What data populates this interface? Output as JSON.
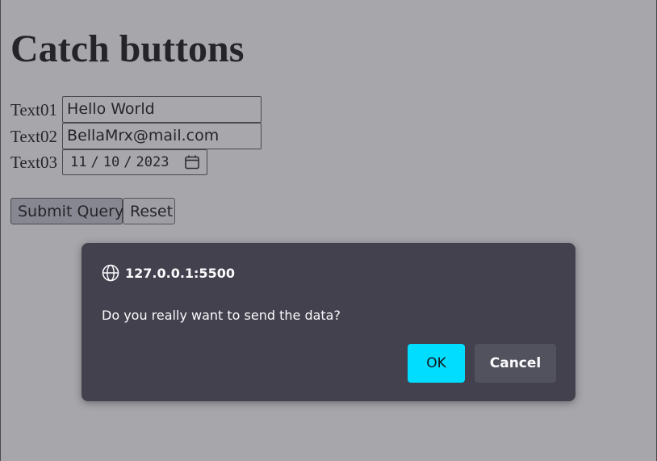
{
  "page": {
    "heading": "Catch buttons"
  },
  "form": {
    "fields": [
      {
        "label": "Text01",
        "value": "Hello World"
      },
      {
        "label": "Text02",
        "value": "BellaMrx@mail.com"
      },
      {
        "label": "Text03",
        "month": "11",
        "day": "10",
        "year": "2023",
        "separator": "/"
      }
    ],
    "submit_label": "Submit Query",
    "reset_label": "Reset"
  },
  "dialog": {
    "origin": "127.0.0.1:5500",
    "message": "Do you really want to send the data?",
    "ok_label": "OK",
    "cancel_label": "Cancel",
    "icons": {
      "origin": "globe-icon",
      "date": "calendar-icon"
    },
    "colors": {
      "dialog_bg": "#42414d",
      "ok_bg": "#00ddff",
      "cancel_bg": "#52525e"
    }
  }
}
